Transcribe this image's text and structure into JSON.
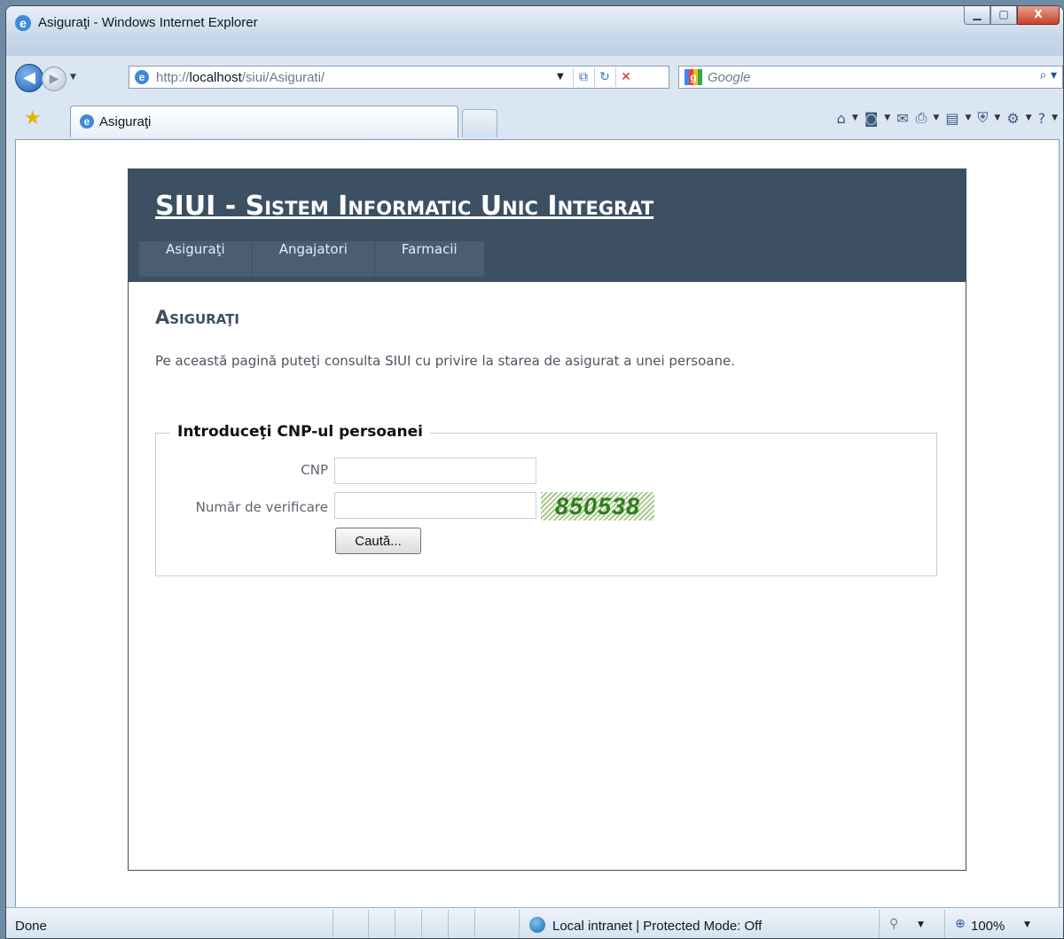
{
  "window": {
    "title": "Asiguraţi - Windows Internet Explorer",
    "controls": {
      "minimize_glyph": "▁",
      "maximize_glyph": "▢",
      "close_glyph": "X"
    }
  },
  "nav": {
    "back_glyph": "◀",
    "forward_glyph": "▶",
    "dropdown_glyph": "▼",
    "address_host": "http://",
    "address_bold": "localhost",
    "address_path": "/siui/Asigurati/",
    "search_placeholder": "Google"
  },
  "tab": {
    "label": "Asiguraţi"
  },
  "site": {
    "title": "SIUI - Sistem Informatic Unic Integrat",
    "menu": [
      "Asiguraţi",
      "Angajatori",
      "Farmacii"
    ]
  },
  "content": {
    "heading": "Asiguraţi",
    "intro": "Pe această pagină puteţi consulta SIUI cu privire la starea de asigurat a unei persoane.",
    "form": {
      "legend": "Introduceţi CNP-ul persoanei",
      "cnp_label": "CNP",
      "cnp_value": "",
      "verification_label": "Număr de verificare",
      "verification_value": "",
      "captcha": "850538",
      "submit_label": "Caută..."
    }
  },
  "status": {
    "text": "Done",
    "zone": "Local intranet | Protected Mode: Off",
    "zoom": "100%"
  },
  "icons": {
    "ie": "ie-logo-icon",
    "favorites": "favorites-star-icon",
    "home": "home-icon",
    "feeds": "feeds-icon",
    "mail": "mail-icon",
    "print": "print-icon",
    "page": "page-icon",
    "safety": "safety-icon",
    "tools": "tools-icon",
    "help": "help-icon"
  },
  "colors": {
    "header_bg": "#3d4f63",
    "menu_bg": "#4a5d72",
    "captcha_text": "#2f7d1e"
  }
}
